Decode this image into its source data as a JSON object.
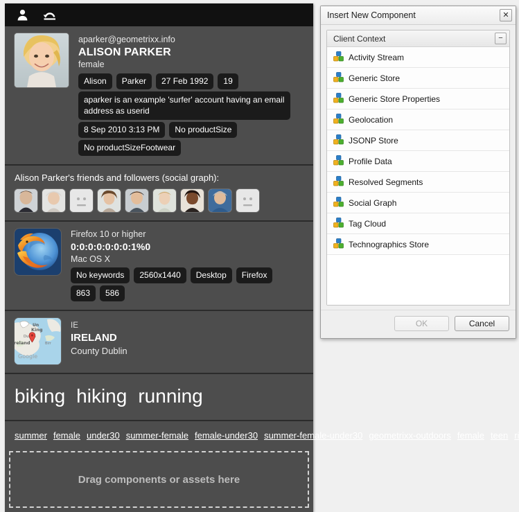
{
  "toolbar": {
    "icons": [
      {
        "name": "person-icon",
        "title": "Profile"
      },
      {
        "name": "reset-icon",
        "title": "Reset"
      }
    ]
  },
  "profile": {
    "email": "aparker@geometrixx.info",
    "name": "ALISON PARKER",
    "gender": "female",
    "pills": [
      "Alison",
      "Parker",
      "27 Feb 1992",
      "19"
    ],
    "about": "aparker is an example 'surfer' account having an email address as userid",
    "pills2": [
      "8 Sep 2010 3:13 PM",
      "No productSize"
    ],
    "pills3": [
      "No productSizeFootwear"
    ]
  },
  "social_graph": {
    "title": "Alison Parker's friends and followers (social graph):",
    "avatars": [
      {
        "kind": "photo",
        "skin": "#d8b79a",
        "hair": "#3a2a20",
        "bg": "#cfd3d6"
      },
      {
        "kind": "photo",
        "skin": "#e8c9ae",
        "hair": "#d8d6d2",
        "bg": "#e4e4e2"
      },
      {
        "kind": "placeholder"
      },
      {
        "kind": "photo",
        "skin": "#e5c2a4",
        "hair": "#6b4a2e",
        "bg": "#dfe2e0"
      },
      {
        "kind": "photo",
        "skin": "#e3bd9b",
        "hair": "#2e2018",
        "bg": "#c8cdd1"
      },
      {
        "kind": "photo",
        "skin": "#ecd0b6",
        "hair": "#c9a86c",
        "bg": "#dfe3dc"
      },
      {
        "kind": "photo",
        "skin": "#7a4a2c",
        "hair": "#241610",
        "bg": "#e8e2d8"
      },
      {
        "kind": "photo",
        "skin": "#e0bb9a",
        "hair": "#bcbcbc",
        "bg": "#3f6c9c"
      },
      {
        "kind": "placeholder"
      }
    ]
  },
  "technographics": {
    "browser_version": "Firefox 10 or higher",
    "ip": "0:0:0:0:0:0:0:1%0",
    "os": "Mac OS X",
    "pills": [
      "No keywords",
      "2560x1440",
      "Desktop",
      "Firefox"
    ],
    "pills2": [
      "863",
      "586"
    ]
  },
  "geolocation": {
    "country_code": "IE",
    "country": "IRELAND",
    "region": "County Dublin",
    "map_labels": {
      "city": "Dublin",
      "country": "Ireland",
      "uk": "United Kingdom",
      "attribution": "Google"
    }
  },
  "tag_cloud": {
    "tags": [
      "biking",
      "hiking",
      "running"
    ]
  },
  "segments": {
    "items": [
      "summer",
      "female",
      "under30",
      "summer-female",
      "female-under30",
      "summer-female-under30",
      "geometrixx-outdoors",
      "female",
      "teen",
      "right"
    ]
  },
  "dropzone": {
    "label": "Drag components or assets here"
  },
  "dialog": {
    "title": "Insert New Component",
    "close_label": "✕",
    "group": {
      "title": "Client Context",
      "collapse_label": "−"
    },
    "components": [
      "Activity Stream",
      "Generic Store",
      "Generic Store Properties",
      "Geolocation",
      "JSONP Store",
      "Profile Data",
      "Resolved Segments",
      "Social Graph",
      "Tag Cloud",
      "Technographics Store"
    ],
    "buttons": {
      "ok": "OK",
      "cancel": "Cancel"
    }
  },
  "colors": {
    "panel_bg": "#4d4d4d",
    "toolbar_bg": "#111111",
    "pill_bg": "#1b1b1b",
    "page_bg": "#f0f0f0",
    "dialog_bg": "#efefef",
    "accent_blue": "#2a7fc9"
  }
}
